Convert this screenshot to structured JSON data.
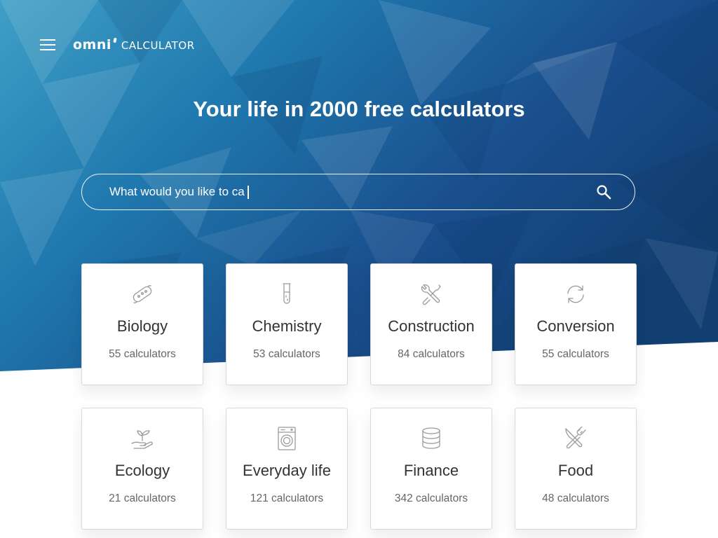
{
  "header": {
    "logo_word": "omni",
    "logo_suffix": "CALCULATOR"
  },
  "hero": {
    "headline": "Your life in 2000 free calculators"
  },
  "search": {
    "value": "What would you like to ca"
  },
  "colors": {
    "hero_dark": "#12447a",
    "hero_light": "#3a9bc4",
    "card_title": "#333333",
    "card_count": "#666666",
    "icon_stroke": "#9a9a9a"
  },
  "categories": [
    {
      "name": "Biology",
      "count": "55 calculators",
      "icon": "bacteria-icon"
    },
    {
      "name": "Chemistry",
      "count": "53 calculators",
      "icon": "test-tube-icon"
    },
    {
      "name": "Construction",
      "count": "84 calculators",
      "icon": "tools-icon"
    },
    {
      "name": "Conversion",
      "count": "55 calculators",
      "icon": "refresh-arrows-icon"
    },
    {
      "name": "Ecology",
      "count": "21 calculators",
      "icon": "plant-in-hand-icon"
    },
    {
      "name": "Everyday life",
      "count": "121 calculators",
      "icon": "washing-machine-icon"
    },
    {
      "name": "Finance",
      "count": "342 calculators",
      "icon": "coin-stack-icon"
    },
    {
      "name": "Food",
      "count": "48 calculators",
      "icon": "fork-knife-icon"
    }
  ]
}
